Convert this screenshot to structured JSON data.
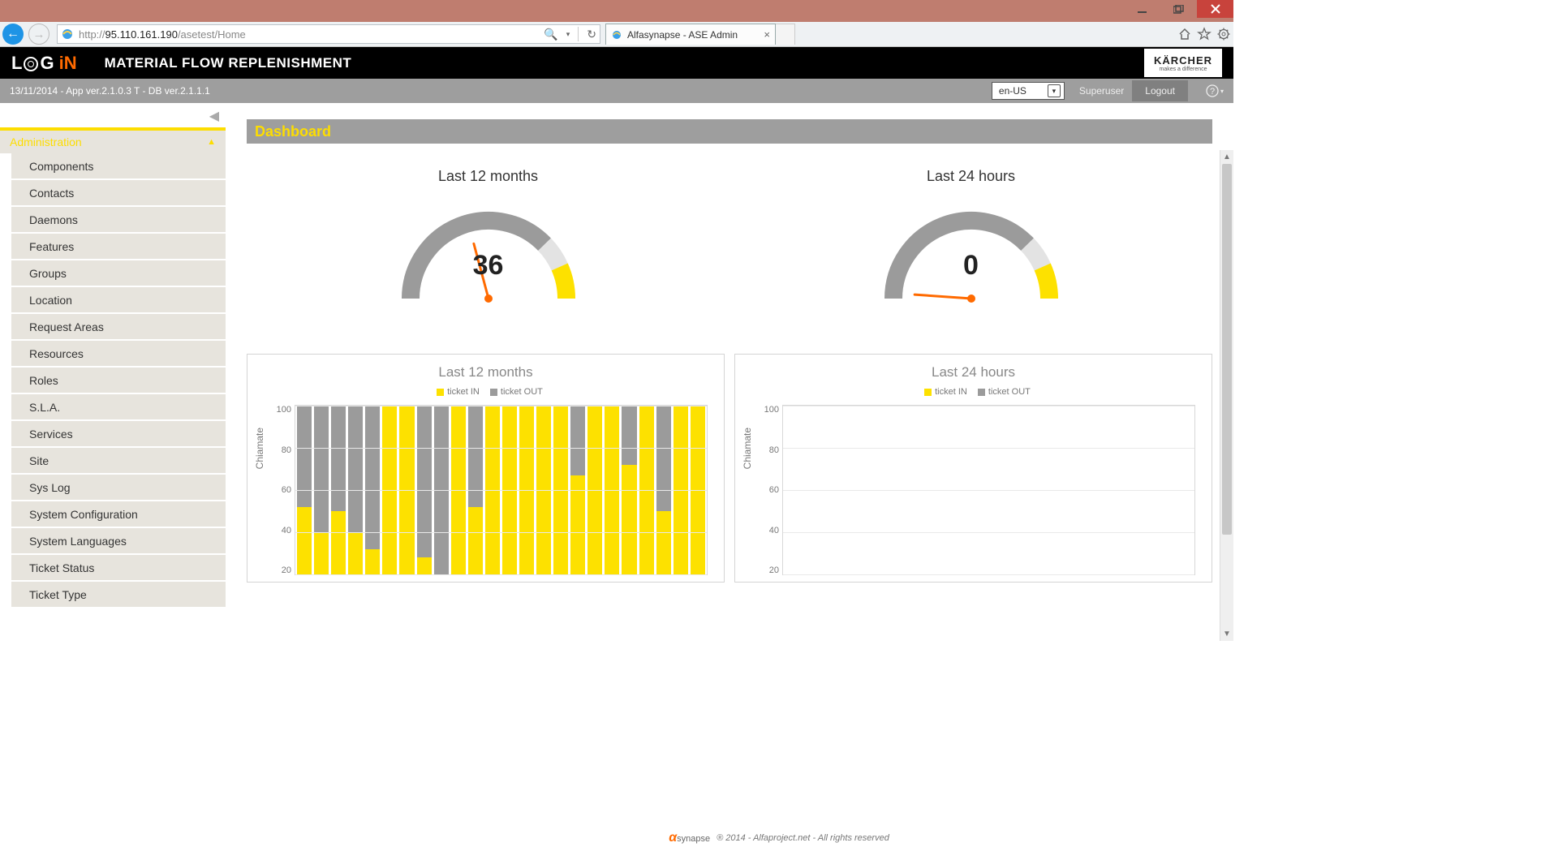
{
  "browser": {
    "url_prefix": "http://",
    "url_host": "95.110.161.190",
    "url_path": "/asetest/Home",
    "tab_title": "Alfasynapse - ASE Admin"
  },
  "app": {
    "logo_main": "L",
    "logo_mid": "G",
    "logo_in": "iN",
    "title": "MATERIAL FLOW REPLENISHMENT",
    "brand": "KÄRCHER",
    "brand_sub": "makes a difference"
  },
  "greybar": {
    "status": "13/11/2014 - App ver.2.1.0.3 T - DB ver.2.1.1.1",
    "locale": "en-US",
    "user": "Superuser",
    "logout": "Logout"
  },
  "sidebar": {
    "header": "Administration",
    "items": [
      "Components",
      "Contacts",
      "Daemons",
      "Features",
      "Groups",
      "Location",
      "Request Areas",
      "Resources",
      "Roles",
      "S.L.A.",
      "Services",
      "Site",
      "Sys Log",
      "System Configuration",
      "System Languages",
      "Ticket Status",
      "Ticket Type"
    ]
  },
  "main": {
    "title": "Dashboard",
    "gauges": [
      {
        "title": "Last 12 months",
        "value": "36",
        "angle": -40
      },
      {
        "title": "Last 24 hours",
        "value": "0",
        "angle": -90
      }
    ],
    "chart_left_title": "Last 12 months",
    "chart_right_title": "Last 24 hours",
    "legend_in": "ticket IN",
    "legend_out": "ticket OUT",
    "ylabel": "Chiamate",
    "yticks": [
      "100",
      "80",
      "60",
      "40",
      "20"
    ]
  },
  "chart_data": [
    {
      "type": "bar",
      "title": "Last 12 months",
      "ylabel": "Chiamate",
      "ylim": [
        0,
        100
      ],
      "stacked": true,
      "legend": [
        "ticket IN",
        "ticket OUT"
      ],
      "series": [
        {
          "name": "ticket IN",
          "values": [
            52,
            40,
            50,
            40,
            32,
            100,
            100,
            28,
            17,
            100,
            52,
            100,
            100,
            100,
            100,
            100,
            67,
            100,
            100,
            72,
            100,
            50,
            100,
            100
          ]
        },
        {
          "name": "ticket OUT",
          "values": [
            48,
            60,
            50,
            60,
            68,
            0,
            0,
            72,
            83,
            0,
            48,
            0,
            0,
            0,
            0,
            0,
            33,
            0,
            0,
            28,
            0,
            50,
            0,
            0
          ]
        }
      ]
    },
    {
      "type": "bar",
      "title": "Last 24 hours",
      "ylabel": "Chiamate",
      "ylim": [
        0,
        100
      ],
      "stacked": true,
      "legend": [
        "ticket IN",
        "ticket OUT"
      ],
      "series": [
        {
          "name": "ticket IN",
          "values": []
        },
        {
          "name": "ticket OUT",
          "values": []
        }
      ]
    }
  ],
  "footer": {
    "text": "® 2014 - Alfaproject.net - All rights reserved",
    "brand": "synapse"
  }
}
